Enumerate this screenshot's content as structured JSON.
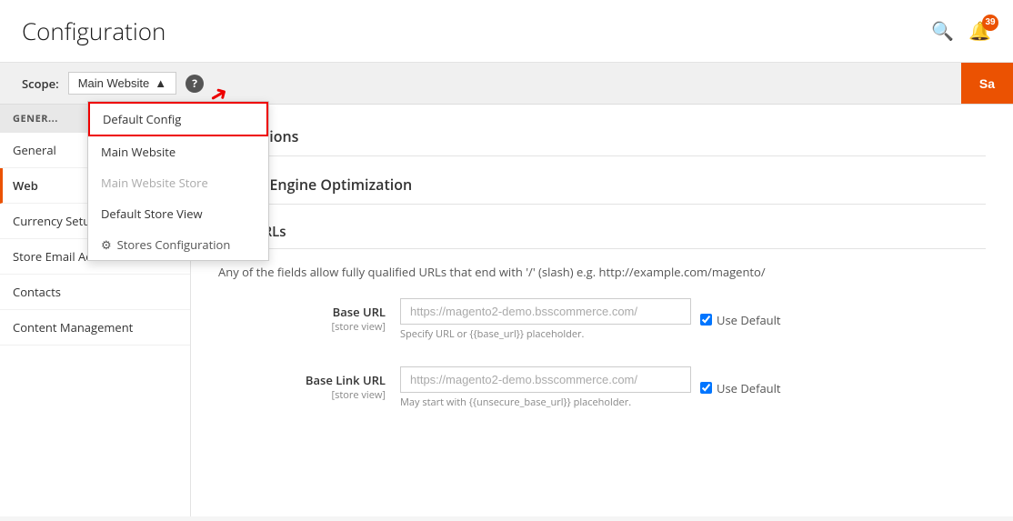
{
  "header": {
    "title": "Configuration",
    "search_icon": "search",
    "notification_icon": "bell",
    "notification_count": "39"
  },
  "scope": {
    "label": "Scope:",
    "current_value": "Main Website",
    "arrow_icon": "▲",
    "help_icon": "?",
    "save_label": "Sa"
  },
  "dropdown": {
    "items": [
      {
        "label": "Default Config",
        "selected": true,
        "disabled": false,
        "icon": null
      },
      {
        "label": "Main Website",
        "selected": false,
        "disabled": false,
        "icon": null
      },
      {
        "label": "Main Website Store",
        "selected": false,
        "disabled": true,
        "icon": null
      },
      {
        "label": "Default Store View",
        "selected": false,
        "disabled": false,
        "icon": null
      },
      {
        "label": "Stores Configuration",
        "selected": false,
        "disabled": false,
        "icon": "⚙"
      }
    ]
  },
  "sidebar": {
    "section_header": "GENER...",
    "items": [
      {
        "label": "General",
        "active": false
      },
      {
        "label": "Web",
        "active": true
      },
      {
        "label": "Currency Setup",
        "active": false
      },
      {
        "label": "Store Email Addresses",
        "active": false
      },
      {
        "label": "Contacts",
        "active": false
      },
      {
        "label": "Content Management",
        "active": false
      }
    ]
  },
  "main": {
    "url_options_title": "Url Options",
    "seo_title": "Search Engine Optimization",
    "base_urls_title": "Base URLs",
    "base_urls_desc": "Any of the fields allow fully qualified URLs that end with '/' (slash) e.g. http://example.com/magento/",
    "base_url_label": "Base URL",
    "base_url_sublabel": "[store view]",
    "base_url_placeholder": "https://magento2-demo.bsscommerce.com/",
    "base_url_hint": "Specify URL or {{base_url}} placeholder.",
    "base_url_checkbox": "Use Default",
    "base_link_url_label": "Base Link URL",
    "base_link_url_sublabel": "[store view]",
    "base_link_url_placeholder": "https://magento2-demo.bsscommerce.com/",
    "base_link_url_hint": "May start with {{unsecure_base_url}} placeholder.",
    "base_link_url_checkbox": "Use Default"
  }
}
